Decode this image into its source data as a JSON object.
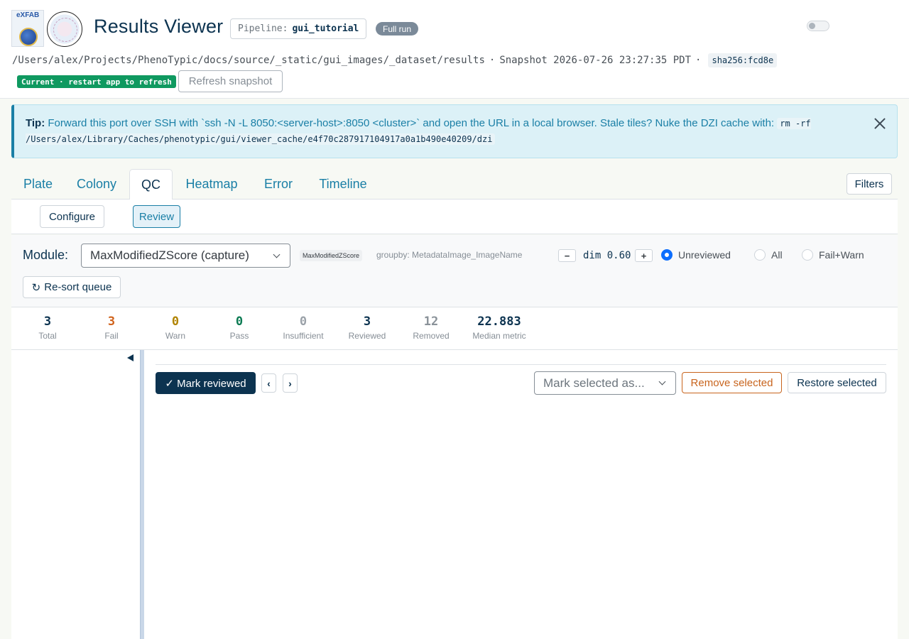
{
  "header": {
    "title": "Results Viewer",
    "pipeline_key": "Pipeline:",
    "pipeline_value": "gui_tutorial",
    "run_badge": "Full run",
    "logo_text": "eXFAB",
    "path": "/Users/alex/Projects/PhenoTypic/docs/source/_static/gui_images/_dataset/results",
    "snapshot": "Snapshot 2026-07-26 23:27:35 PDT",
    "sep": "·",
    "hash": "sha256:fcd8e",
    "current_badge": "Current · restart app to refresh",
    "refresh_button": "Refresh snapshot"
  },
  "tip": {
    "label": "Tip:",
    "text": "Forward this port over SSH with `ssh -N -L 8050:<server-host>:8050 <cluster>` and open the URL in a local browser. Stale tiles? Nuke the DZI cache with:",
    "code": "rm -rf /Users/alex/Library/Caches/phenotypic/gui/viewer_cache/e4f70c287917104917a0a1b490e40209/dzi"
  },
  "tabs": [
    "Plate",
    "Colony",
    "QC",
    "Heatmap",
    "Error",
    "Timeline"
  ],
  "active_tab": "QC",
  "filters_button": "Filters",
  "subtabs": [
    "Configure",
    "Review"
  ],
  "active_subtab": "Review",
  "controls": {
    "module_label": "Module:",
    "module_value": "MaxModifiedZScore (capture)",
    "module_tag": "MaxModifiedZScore",
    "groupby": "groupby: MetadataImage_ImageName",
    "dim_minus": "−",
    "dim_label": "dim 0.60",
    "dim_plus": "+",
    "radios": [
      "Unreviewed",
      "All",
      "Fail+Warn"
    ],
    "radio_selected": "Unreviewed",
    "resort_icon": "↻",
    "resort_button": "Re-sort queue"
  },
  "stats": [
    {
      "value": "3",
      "label": "Total",
      "color": "#0c3350"
    },
    {
      "value": "3",
      "label": "Fail",
      "color": "#d0621b"
    },
    {
      "value": "0",
      "label": "Warn",
      "color": "#b08300"
    },
    {
      "value": "0",
      "label": "Pass",
      "color": "#0a7a52"
    },
    {
      "value": "0",
      "label": "Insufficient",
      "color": "#9aa1a8"
    },
    {
      "value": "3",
      "label": "Reviewed",
      "color": "#0c3350"
    },
    {
      "value": "12",
      "label": "Removed",
      "color": "#8a9299"
    },
    {
      "value": "22.883",
      "label": "Median metric",
      "color": "#0c3350"
    }
  ],
  "review": {
    "mark_reviewed": "✓ Mark reviewed",
    "prev": "‹",
    "next": "›",
    "mark_select_placeholder": "Mark selected as...",
    "remove_selected": "Remove selected",
    "restore_selected": "Restore selected"
  }
}
